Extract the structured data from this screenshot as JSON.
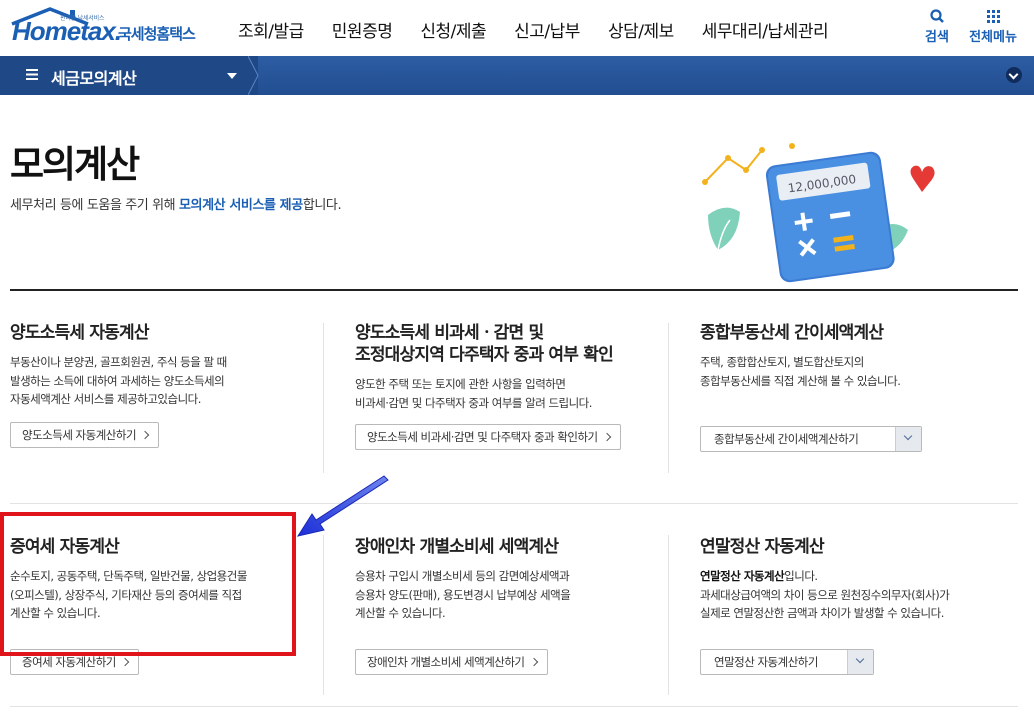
{
  "header": {
    "logo_small": "편리한 납세서비스",
    "logo_main": "Hometax.",
    "logo_sub": "국세청홈택스",
    "nav": [
      "조회/발급",
      "민원증명",
      "신청/제출",
      "신고/납부",
      "상담/제보",
      "세무대리/납세관리"
    ],
    "search_label": "검색",
    "menu_label": "전체메뉴"
  },
  "subbar": {
    "title": "세금모의계산"
  },
  "page": {
    "title": "모의계산",
    "desc_pre": "세무처리 등에 도움을 주기 위해 ",
    "desc_hl": "모의계산 서비스를 제공",
    "desc_post": "합니다.",
    "illustration_value": "12,000,000"
  },
  "cards": [
    {
      "title": "양도소득세 자동계산",
      "desc": [
        "부동산이나 분양권, 골프회원권, 주식 등을 팔 때",
        "발생하는 소득에 대하여 과세하는 양도소득세의",
        "자동세액계산 서비스를 제공하고있습니다."
      ],
      "button": "양도소득세 자동계산하기"
    },
    {
      "title_lines": [
        "양도소득세 비과세ㆍ감면 및",
        "조정대상지역 다주택자 중과 여부 확인"
      ],
      "desc": [
        "양도한 주택 또는 토지에 관한 사항을 입력하면",
        "비과세·감면 및 다주택자 중과 여부를 알려 드립니다."
      ],
      "button": "양도소득세 비과세·감면 및 다주택자 중과 확인하기"
    },
    {
      "title": "종합부동산세 간이세액계산",
      "desc": [
        "주택, 종합합산토지, 별도합산토지의",
        "종합부동산세를 직접 계산해 볼 수 있습니다."
      ],
      "select": "종합부동산세 간이세액계산하기"
    },
    {
      "title": "증여세 자동계산",
      "desc": [
        "순수토지, 공동주택, 단독주택, 일반건물, 상업용건물",
        "(오피스텔), 상장주식, 기타재산 등의 증여세를 직접",
        "계산할 수 있습니다."
      ],
      "button": "증여세 자동계산하기"
    },
    {
      "title": "장애인차 개별소비세 세액계산",
      "desc": [
        "승용차 구입시 개별소비세 등의 감면예상세액과",
        "승용차 양도(판매), 용도변경시 납부예상 세액을",
        "계산할 수 있습니다."
      ],
      "button": "장애인차 개별소비세 세액계산하기"
    },
    {
      "title": "연말정산 자동계산",
      "desc_bold": "연말정산 자동계산",
      "desc_bold_post": "입니다.",
      "desc": [
        "과세대상급여액의 차이 등으로 원천징수의무자(회사)가",
        "실제로 연말정산한 금액과 차이가 발생할 수 있습니다."
      ],
      "select": "연말정산 자동계산하기"
    }
  ],
  "colors": {
    "brand": "#1a5fb4",
    "highlight_box": "#e0141b",
    "arrow": "#1f2fd6"
  }
}
